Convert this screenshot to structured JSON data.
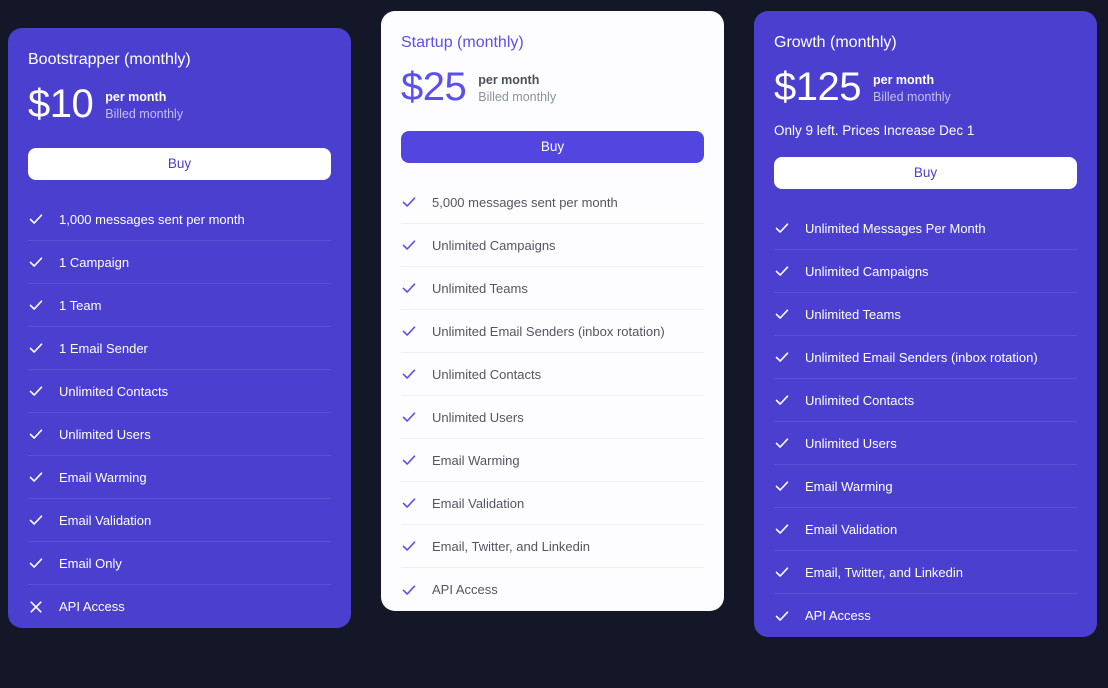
{
  "theme": {
    "page_background": "#131728",
    "purple_card_background": "#4a3fcf",
    "white_card_background": "#fdfdff",
    "accent_purple": "#5b4ff0"
  },
  "plans": [
    {
      "name": "Bootstrapper (monthly)",
      "price": "$10",
      "per": "per month",
      "billed": "Billed monthly",
      "note": "",
      "buy_label": "Buy",
      "features": [
        {
          "icon": "check-icon",
          "label": "1,000 messages sent per month",
          "included": true
        },
        {
          "icon": "check-icon",
          "label": "1 Campaign",
          "included": true
        },
        {
          "icon": "check-icon",
          "label": "1 Team",
          "included": true
        },
        {
          "icon": "check-icon",
          "label": "1 Email Sender",
          "included": true
        },
        {
          "icon": "check-icon",
          "label": "Unlimited Contacts",
          "included": true
        },
        {
          "icon": "check-icon",
          "label": "Unlimited Users",
          "included": true
        },
        {
          "icon": "check-icon",
          "label": "Email Warming",
          "included": true
        },
        {
          "icon": "check-icon",
          "label": "Email Validation",
          "included": true
        },
        {
          "icon": "check-icon",
          "label": "Email Only",
          "included": true
        },
        {
          "icon": "x-icon",
          "label": "API Access",
          "included": false
        }
      ]
    },
    {
      "name": "Startup (monthly)",
      "price": "$25",
      "per": "per month",
      "billed": "Billed monthly",
      "note": "",
      "buy_label": "Buy",
      "features": [
        {
          "icon": "check-icon",
          "label": "5,000 messages sent per month",
          "included": true
        },
        {
          "icon": "check-icon",
          "label": "Unlimited Campaigns",
          "included": true
        },
        {
          "icon": "check-icon",
          "label": "Unlimited Teams",
          "included": true
        },
        {
          "icon": "check-icon",
          "label": "Unlimited Email Senders (inbox rotation)",
          "included": true
        },
        {
          "icon": "check-icon",
          "label": "Unlimited Contacts",
          "included": true
        },
        {
          "icon": "check-icon",
          "label": "Unlimited Users",
          "included": true
        },
        {
          "icon": "check-icon",
          "label": "Email Warming",
          "included": true
        },
        {
          "icon": "check-icon",
          "label": "Email Validation",
          "included": true
        },
        {
          "icon": "check-icon",
          "label": "Email, Twitter, and Linkedin",
          "included": true
        },
        {
          "icon": "check-icon",
          "label": "API Access",
          "included": true
        }
      ]
    },
    {
      "name": "Growth (monthly)",
      "price": "$125",
      "per": "per month",
      "billed": "Billed monthly",
      "note": "Only 9 left. Prices Increase Dec 1",
      "buy_label": "Buy",
      "features": [
        {
          "icon": "check-icon",
          "label": "Unlimited Messages Per Month",
          "included": true
        },
        {
          "icon": "check-icon",
          "label": "Unlimited Campaigns",
          "included": true
        },
        {
          "icon": "check-icon",
          "label": "Unlimited Teams",
          "included": true
        },
        {
          "icon": "check-icon",
          "label": "Unlimited Email Senders (inbox rotation)",
          "included": true
        },
        {
          "icon": "check-icon",
          "label": "Unlimited Contacts",
          "included": true
        },
        {
          "icon": "check-icon",
          "label": "Unlimited Users",
          "included": true
        },
        {
          "icon": "check-icon",
          "label": "Email Warming",
          "included": true
        },
        {
          "icon": "check-icon",
          "label": "Email Validation",
          "included": true
        },
        {
          "icon": "check-icon",
          "label": "Email, Twitter, and Linkedin",
          "included": true
        },
        {
          "icon": "check-icon",
          "label": "API Access",
          "included": true
        }
      ]
    }
  ]
}
